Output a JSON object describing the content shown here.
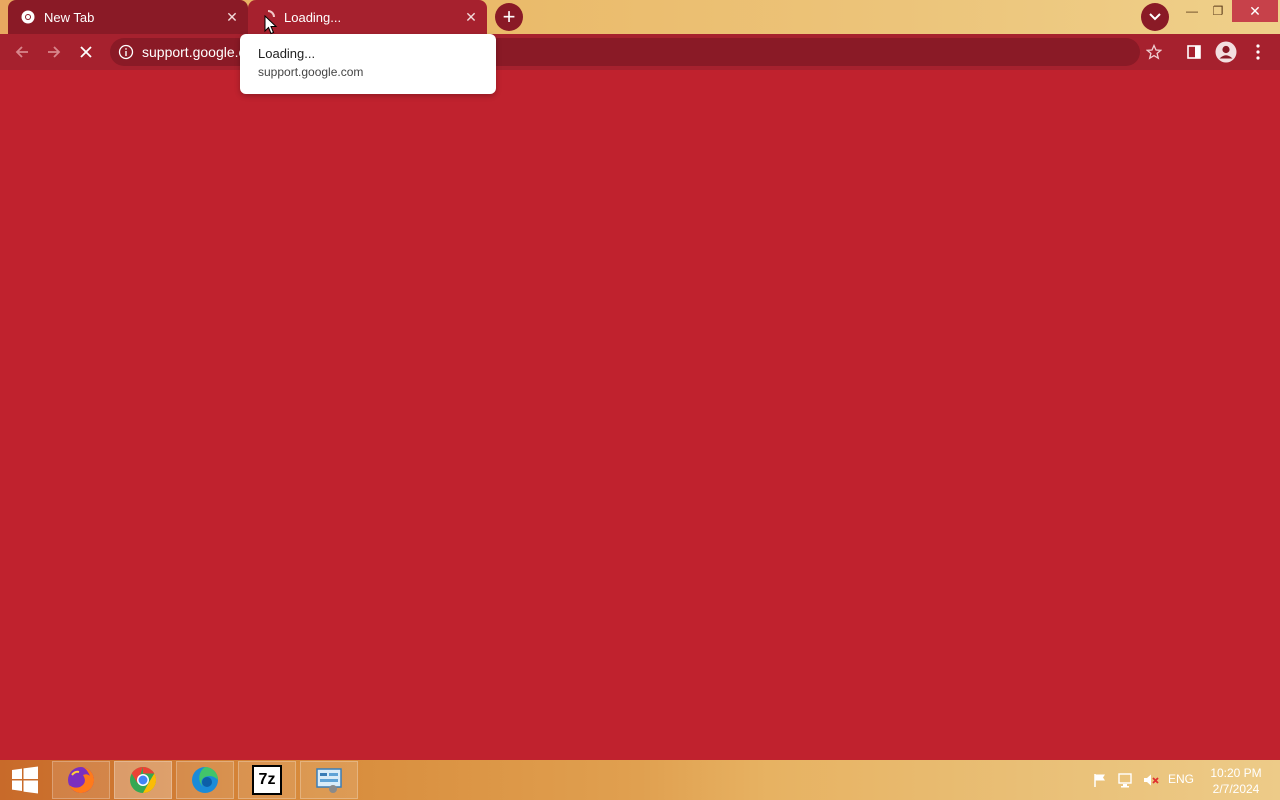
{
  "browser": {
    "tabs": [
      {
        "title": "New Tab",
        "icon": "chrome-icon",
        "active": false
      },
      {
        "title": "Loading...",
        "icon": "loading-spinner-icon",
        "active": true
      }
    ],
    "tab_close_glyph": "✕",
    "new_tab_glyph": "+",
    "hover_card": {
      "title": "Loading...",
      "url": "support.google.com"
    },
    "address_bar": {
      "url": "support.google.com"
    },
    "window_controls": {
      "minimize": "—",
      "maximize": "❐",
      "close": "✕"
    }
  },
  "taskbar": {
    "apps": [
      {
        "name": "Firefox",
        "icon": "firefox-icon"
      },
      {
        "name": "Google Chrome",
        "icon": "chrome-icon"
      },
      {
        "name": "Edge",
        "icon": "edge-icon"
      },
      {
        "name": "7-Zip",
        "icon": "7zip-icon",
        "label": "7z"
      },
      {
        "name": "Control Panel",
        "icon": "control-panel-icon"
      }
    ],
    "language": "ENG",
    "time": "10:20 PM",
    "date": "2/7/2024"
  },
  "colors": {
    "page_background": "#c0222e",
    "toolbar": "#a6212e",
    "tab_inactive": "#8a1a26",
    "titlebar": "#eab968"
  }
}
